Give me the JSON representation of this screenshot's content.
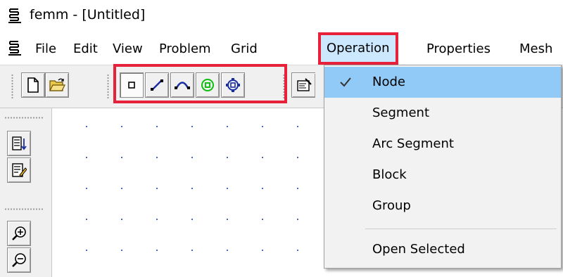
{
  "window": {
    "title": "femm - [Untitled]"
  },
  "menubar": {
    "items": [
      {
        "label": "File"
      },
      {
        "label": "Edit"
      },
      {
        "label": "View"
      },
      {
        "label": "Problem"
      },
      {
        "label": "Grid"
      },
      {
        "label": "Operation"
      },
      {
        "label": "Properties"
      },
      {
        "label": "Mesh"
      }
    ],
    "open_menu": "Operation"
  },
  "toolbar": {
    "buttons": [
      "new-file",
      "open-file",
      "node-mode",
      "segment-mode",
      "arc-segment-mode",
      "block-mode",
      "group-mode",
      "properties"
    ],
    "selected": "node-mode"
  },
  "lefttoolbar": {
    "buttons": [
      "block-label-list",
      "edit-properties",
      "zoom-in",
      "zoom-out"
    ]
  },
  "operation_menu": {
    "items": [
      {
        "label": "Node",
        "checked": true
      },
      {
        "label": "Segment",
        "checked": false
      },
      {
        "label": "Arc Segment",
        "checked": false
      },
      {
        "label": "Block",
        "checked": false
      },
      {
        "label": "Group",
        "checked": false
      },
      {
        "label": "Open Selected",
        "checked": false
      }
    ]
  },
  "colors": {
    "highlight_red": "#e8213a",
    "menu_hover": "#cce8ff",
    "checked_item": "#91c9f7",
    "grid_dot": "#3050b8"
  }
}
